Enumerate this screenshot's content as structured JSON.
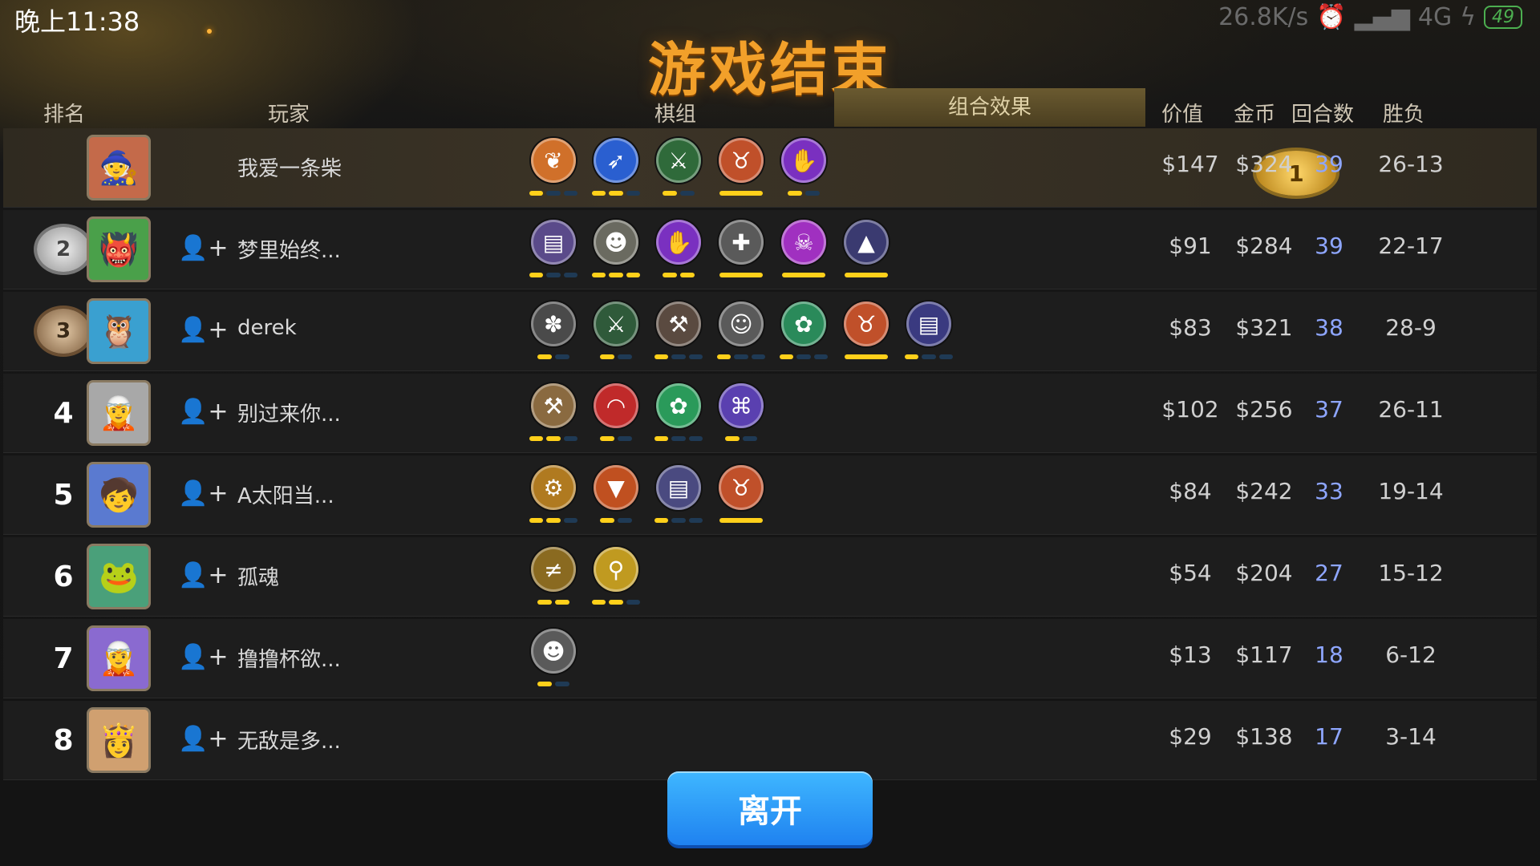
{
  "status_bar": {
    "time": "晚上11:38",
    "speed": "26.8K/s",
    "network": "4G",
    "battery": "49"
  },
  "title": "游戏结束",
  "headers": {
    "rank": "排名",
    "player": "玩家",
    "pieces": "棋组",
    "combo": "组合效果",
    "value": "价值",
    "gold": "金币",
    "rounds": "回合数",
    "winloss": "胜负"
  },
  "players": [
    {
      "rank": "1",
      "medal": "gold",
      "avatar": "🧙",
      "avatar_color": "#c46a4a",
      "name": "我爱一条柴",
      "value": "$147",
      "gold": "$324",
      "rounds": "39",
      "wl": "26-13",
      "pieces": [
        {
          "icon": "leaf-icon",
          "glyph": "❦",
          "color": "#d0702a",
          "bars": [
            1,
            0,
            0
          ]
        },
        {
          "icon": "feather-icon",
          "glyph": "➶",
          "color": "#2a5fd0",
          "bars": [
            1,
            1,
            0
          ]
        },
        {
          "icon": "bow-icon",
          "glyph": "⚔",
          "color": "#2f6a3a",
          "bars": [
            1,
            0
          ]
        },
        {
          "icon": "horned-helmet-icon",
          "glyph": "♉",
          "color": "#c0502a",
          "bars": [
            2
          ]
        },
        {
          "icon": "hand-icon",
          "glyph": "✋",
          "color": "#7a30c0",
          "bars": [
            1,
            0
          ]
        }
      ]
    },
    {
      "rank": "2",
      "medal": "silver",
      "avatar": "👹",
      "avatar_color": "#4aa04a",
      "name": "梦里始终...",
      "value": "$91",
      "gold": "$284",
      "rounds": "39",
      "wl": "22-17",
      "pieces": [
        {
          "icon": "book-icon",
          "glyph": "▤",
          "color": "#5a4a8a",
          "bars": [
            1,
            0,
            0
          ]
        },
        {
          "icon": "penguin-icon",
          "glyph": "☻",
          "color": "#6a6a60",
          "bars": [
            1,
            1,
            1
          ]
        },
        {
          "icon": "hand-icon",
          "glyph": "✋",
          "color": "#7a30c0",
          "bars": [
            1,
            1
          ]
        },
        {
          "icon": "cross-icon",
          "glyph": "✚",
          "color": "#5a5a5a",
          "bars": [
            2
          ]
        },
        {
          "icon": "demon-icon",
          "glyph": "☠",
          "color": "#a030c0",
          "bars": [
            2
          ]
        },
        {
          "icon": "wizard-hat-icon",
          "glyph": "▲",
          "color": "#3a3a70",
          "bars": [
            2
          ]
        }
      ]
    },
    {
      "rank": "3",
      "medal": "bronze",
      "avatar": "🦉",
      "avatar_color": "#3aa0d0",
      "name": "derek",
      "value": "$83",
      "gold": "$321",
      "rounds": "38",
      "wl": "28-9",
      "pieces": [
        {
          "icon": "cluster-icon",
          "glyph": "✽",
          "color": "#4a4a4a",
          "bars": [
            1,
            0
          ]
        },
        {
          "icon": "bow-icon",
          "glyph": "⚔",
          "color": "#2f5a3a",
          "bars": [
            1,
            0
          ]
        },
        {
          "icon": "axe-icon",
          "glyph": "⚒",
          "color": "#5a4a40",
          "bars": [
            1,
            0,
            0
          ]
        },
        {
          "icon": "user-icon",
          "glyph": "☺",
          "color": "#5a5a5a",
          "bars": [
            1,
            0,
            0
          ]
        },
        {
          "icon": "paw-icon",
          "glyph": "✿",
          "color": "#2a8a5a",
          "bars": [
            1,
            0,
            0
          ]
        },
        {
          "icon": "horned-helmet-icon",
          "glyph": "♉",
          "color": "#c0502a",
          "bars": [
            2
          ]
        },
        {
          "icon": "book-icon",
          "glyph": "▤",
          "color": "#3a3a80",
          "bars": [
            1,
            0,
            0
          ]
        }
      ]
    },
    {
      "rank": "4",
      "medal": "",
      "avatar": "🧝",
      "avatar_color": "#a8a8a8",
      "name": "别过来你...",
      "value": "$102",
      "gold": "$256",
      "rounds": "37",
      "wl": "26-11",
      "pieces": [
        {
          "icon": "axe-icon",
          "glyph": "⚒",
          "color": "#8a6a40",
          "bars": [
            1,
            1,
            0
          ]
        },
        {
          "icon": "rainbow-icon",
          "glyph": "◠",
          "color": "#c02a2a",
          "bars": [
            1,
            0
          ]
        },
        {
          "icon": "paw-icon",
          "glyph": "✿",
          "color": "#2a9a5a",
          "bars": [
            1,
            0,
            0
          ]
        },
        {
          "icon": "fishbone-icon",
          "glyph": "⌘",
          "color": "#5a40b0",
          "bars": [
            1,
            0
          ]
        }
      ]
    },
    {
      "rank": "5",
      "medal": "",
      "avatar": "🧒",
      "avatar_color": "#5a7ad0",
      "name": "A太阳当...",
      "value": "$84",
      "gold": "$242",
      "rounds": "33",
      "wl": "19-14",
      "pieces": [
        {
          "icon": "gear-icon",
          "glyph": "⚙",
          "color": "#b07a20",
          "bars": [
            1,
            1,
            0
          ]
        },
        {
          "icon": "fox-icon",
          "glyph": "▼",
          "color": "#c05020",
          "bars": [
            1,
            0
          ]
        },
        {
          "icon": "book-icon",
          "glyph": "▤",
          "color": "#4a4a80",
          "bars": [
            1,
            0,
            0
          ]
        },
        {
          "icon": "horned-helmet-icon",
          "glyph": "♉",
          "color": "#c0502a",
          "bars": [
            2
          ]
        }
      ]
    },
    {
      "rank": "6",
      "medal": "",
      "avatar": "🐸",
      "avatar_color": "#4aa07a",
      "name": "孤魂",
      "value": "$54",
      "gold": "$204",
      "rounds": "27",
      "wl": "15-12",
      "pieces": [
        {
          "icon": "claw-icon",
          "glyph": "≠",
          "color": "#8a6a20",
          "bars": [
            1,
            1
          ]
        },
        {
          "icon": "keyhole-icon",
          "glyph": "⚲",
          "color": "#c09a20",
          "bars": [
            1,
            1,
            0
          ]
        }
      ]
    },
    {
      "rank": "7",
      "medal": "",
      "avatar": "🧝",
      "avatar_color": "#8a6ad0",
      "name": "撸撸杯欲...",
      "value": "$13",
      "gold": "$117",
      "rounds": "18",
      "wl": "6-12",
      "pieces": [
        {
          "icon": "penguin-icon",
          "glyph": "☻",
          "color": "#5a5a5a",
          "bars": [
            1,
            0
          ]
        }
      ]
    },
    {
      "rank": "8",
      "medal": "",
      "avatar": "👸",
      "avatar_color": "#d0a070",
      "name": "无敌是多...",
      "value": "$29",
      "gold": "$138",
      "rounds": "17",
      "wl": "3-14",
      "pieces": []
    }
  ],
  "leave_button": "离开"
}
